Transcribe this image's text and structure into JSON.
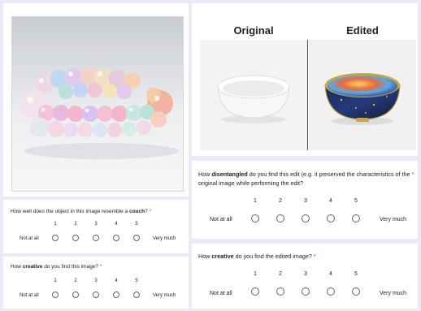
{
  "images": {
    "left_subject": "couch made of pastel bubbles",
    "original_heading": "Original",
    "edited_heading": "Edited"
  },
  "questions": [
    {
      "id": "resemble",
      "prefix": "How well does the object in this image resemble a ",
      "bold": "couch",
      "suffix": "?",
      "required": "*",
      "scale": [
        "1",
        "2",
        "3",
        "4",
        "5"
      ],
      "low_label": "Not at all",
      "high_label": "Very much"
    },
    {
      "id": "creative_left",
      "prefix": "How ",
      "bold": "creative",
      "suffix": " do you find this image?",
      "required": "*",
      "scale": [
        "1",
        "2",
        "3",
        "4",
        "5"
      ],
      "low_label": "Not at all",
      "high_label": "Very much"
    },
    {
      "id": "disentangled",
      "prefix": "How ",
      "bold": "disentangled",
      "suffix": " do you find this edit (e.g. it preserved the characteristics of the",
      "line2": "original image while performing the edit?",
      "required": "*",
      "scale": [
        "1",
        "2",
        "3",
        "4",
        "5"
      ],
      "low_label": "Not at all",
      "high_label": "Very much"
    },
    {
      "id": "creative_edited",
      "prefix": "How ",
      "bold": "creative",
      "suffix": " do you find the edited image?",
      "required": "*",
      "scale": [
        "1",
        "2",
        "3",
        "4",
        "5"
      ],
      "low_label": "Not at all",
      "high_label": "Very much"
    }
  ],
  "colors": {
    "page_background": "#ece9f7",
    "required_star": "#d93025",
    "radio_border": "#5f6368"
  }
}
